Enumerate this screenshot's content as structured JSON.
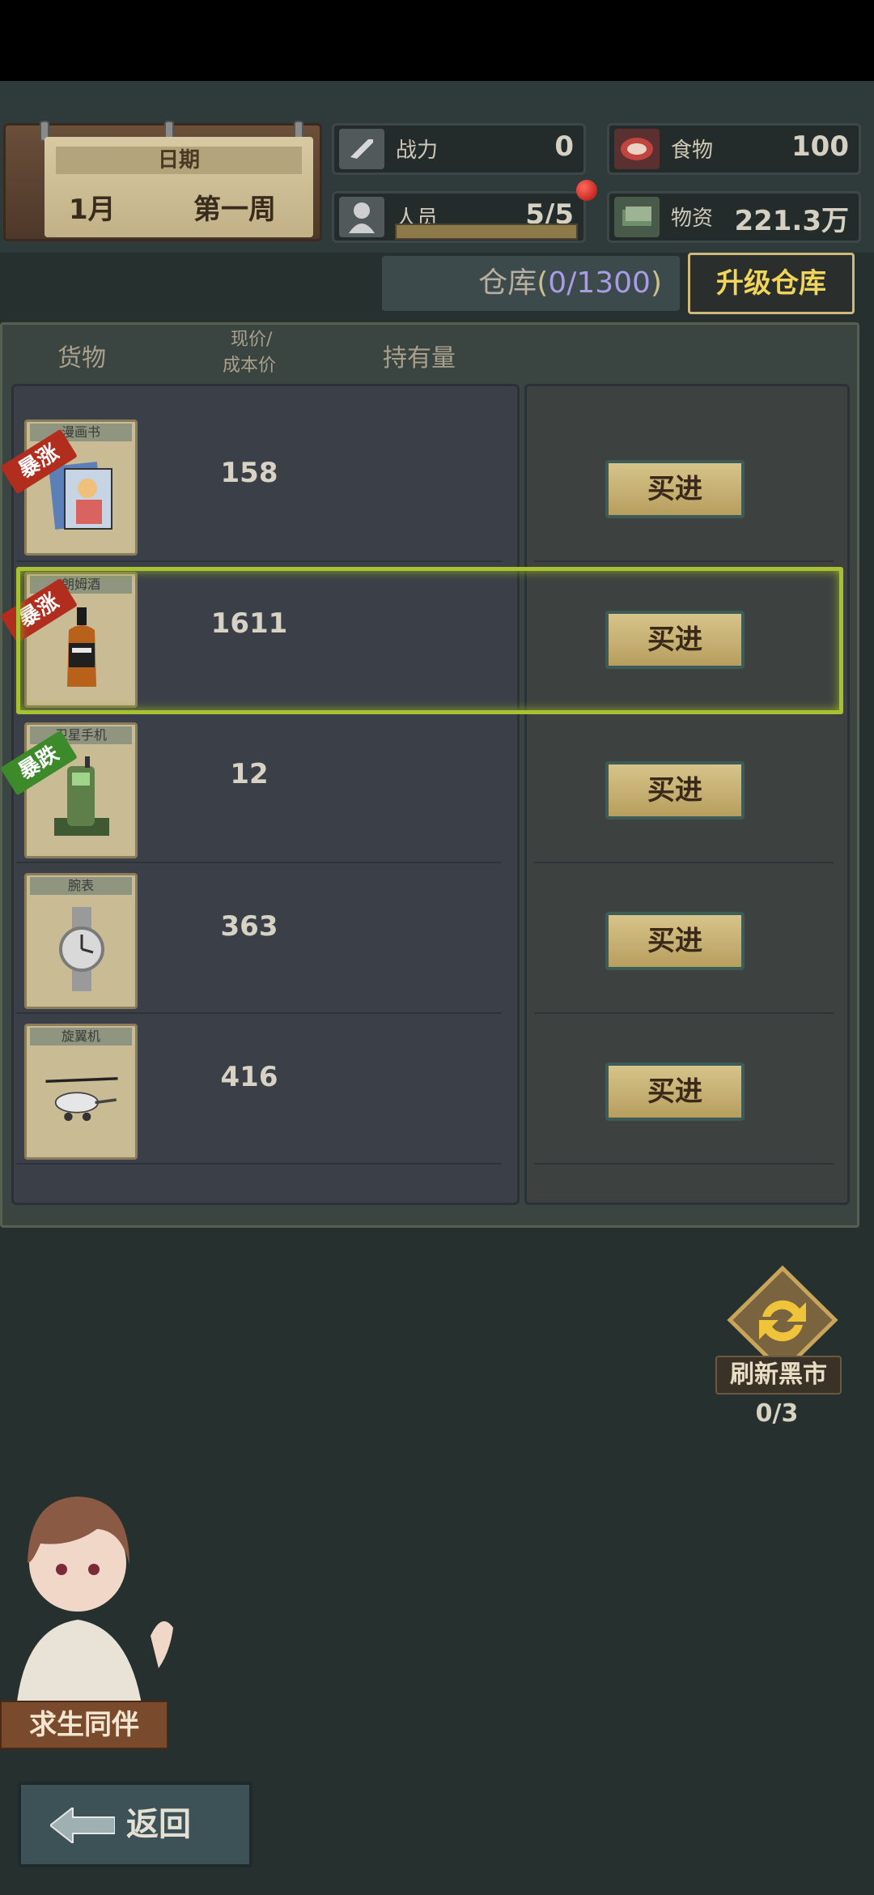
{
  "date": {
    "header": "日期",
    "month": "1月",
    "week": "第一周"
  },
  "stats": {
    "combat": {
      "label": "战力",
      "value": "0",
      "icon": "gun-icon"
    },
    "food": {
      "label": "食物",
      "value": "100",
      "icon": "meat-icon"
    },
    "staff": {
      "label": "人员",
      "value": "5/5",
      "icon": "person-icon",
      "fill": 1.0
    },
    "supplies": {
      "label": "物资",
      "value": "221.3万",
      "icon": "cash-icon"
    }
  },
  "warehouse": {
    "label": "仓库",
    "open": "(",
    "count": "0/1300",
    "close": ")",
    "upgrade_label": "升级仓库"
  },
  "table": {
    "headers": {
      "goods": "货物",
      "price_top": "现价/",
      "price_bottom": "成本价",
      "holding": "持有量"
    },
    "buy_label": "买进",
    "items": [
      {
        "name": "漫画书",
        "price": "158",
        "tag": "暴涨",
        "trend": "up",
        "icon": "comic-book-icon"
      },
      {
        "name": "朗姆酒",
        "price": "1611",
        "tag": "暴涨",
        "trend": "up",
        "icon": "whiskey-bottle-icon"
      },
      {
        "name": "卫星手机",
        "price": "12",
        "tag": "暴跌",
        "trend": "down",
        "icon": "radio-phone-icon"
      },
      {
        "name": "腕表",
        "price": "363",
        "tag": "",
        "trend": "none",
        "icon": "watch-icon"
      },
      {
        "name": "旋翼机",
        "price": "416",
        "tag": "",
        "trend": "none",
        "icon": "gyrocopter-icon"
      }
    ]
  },
  "refresh": {
    "label": "刷新黑市",
    "count": "0/3"
  },
  "companion": {
    "label": "求生同伴"
  },
  "back": {
    "label": "返回"
  },
  "colors": {
    "up_tag": "#b12d1e",
    "down_tag": "#3c8a2a",
    "highlight": "#a7c132",
    "upgrade_text": "#f1d55a"
  }
}
